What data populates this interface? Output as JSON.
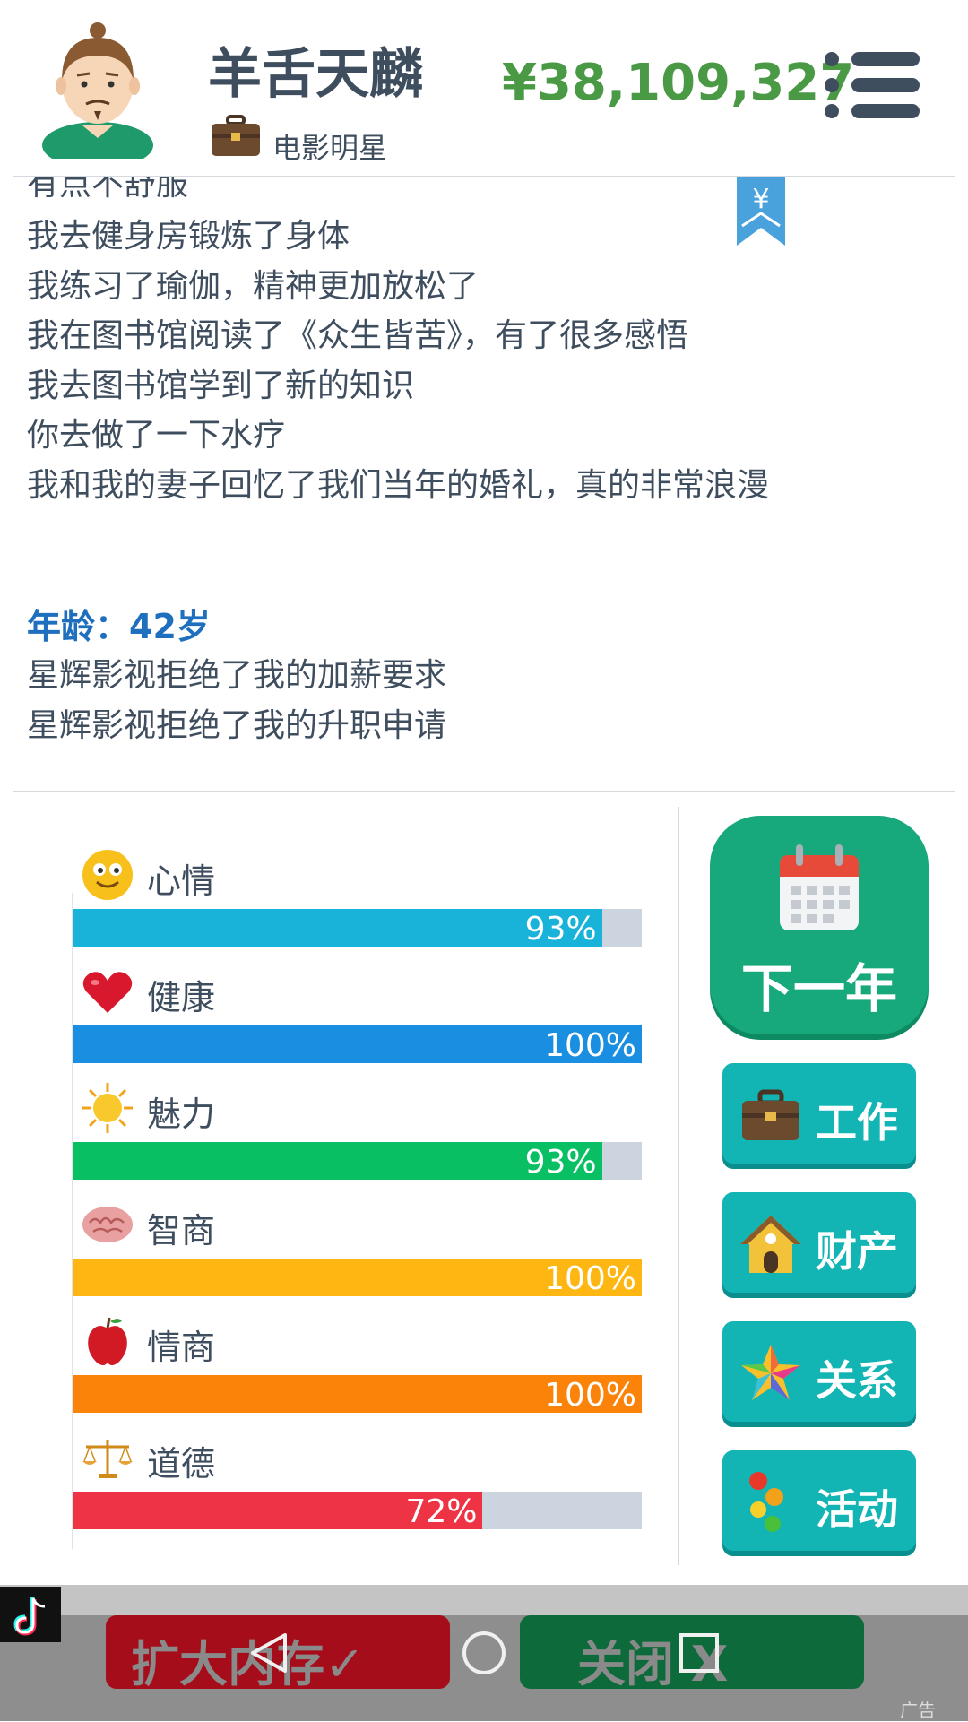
{
  "header": {
    "name": "羊舌天麟",
    "job": "电影明星",
    "money": "¥38,109,327"
  },
  "log": {
    "partial_line": "有点不舒服",
    "lines": [
      "我去健身房锻炼了身体",
      "我练习了瑜伽，精神更加放松了",
      "我在图书馆阅读了《众生皆苦》，有了很多感悟",
      "我去图书馆学到了新的知识",
      "你去做了一下水疗",
      "我和我的妻子回忆了我们当年的婚礼，真的非常浪漫"
    ],
    "age": "年龄：42岁",
    "age_lines": [
      "星辉影视拒绝了我的加薪要求",
      "星辉影视拒绝了我的升职申请"
    ]
  },
  "stats": [
    {
      "label": "心情",
      "value": 93,
      "text": "93%",
      "color": "#19b2d8",
      "icon": "smiley-icon"
    },
    {
      "label": "健康",
      "value": 100,
      "text": "100%",
      "color": "#1a8ee0",
      "icon": "heart-icon"
    },
    {
      "label": "魅力",
      "value": 93,
      "text": "93%",
      "color": "#08c063",
      "icon": "sun-icon"
    },
    {
      "label": "智商",
      "value": 100,
      "text": "100%",
      "color": "#fdb612",
      "icon": "brain-icon"
    },
    {
      "label": "情商",
      "value": 100,
      "text": "100%",
      "color": "#fb8309",
      "icon": "apple-icon"
    },
    {
      "label": "道德",
      "value": 72,
      "text": "72%",
      "color": "#ee3344",
      "icon": "scales-icon"
    }
  ],
  "buttons": {
    "next_year": "下一年",
    "work": "工作",
    "property": "财产",
    "relations": "关系",
    "activities": "活动"
  },
  "ad": {
    "red": "扩大内存✓",
    "green": "关闭 X",
    "tag": "广告"
  },
  "colors": {
    "money": "#4a9a45",
    "age": "#1e6fbd",
    "button_teal": "#12b4b4",
    "next_green": "#17a97b"
  }
}
